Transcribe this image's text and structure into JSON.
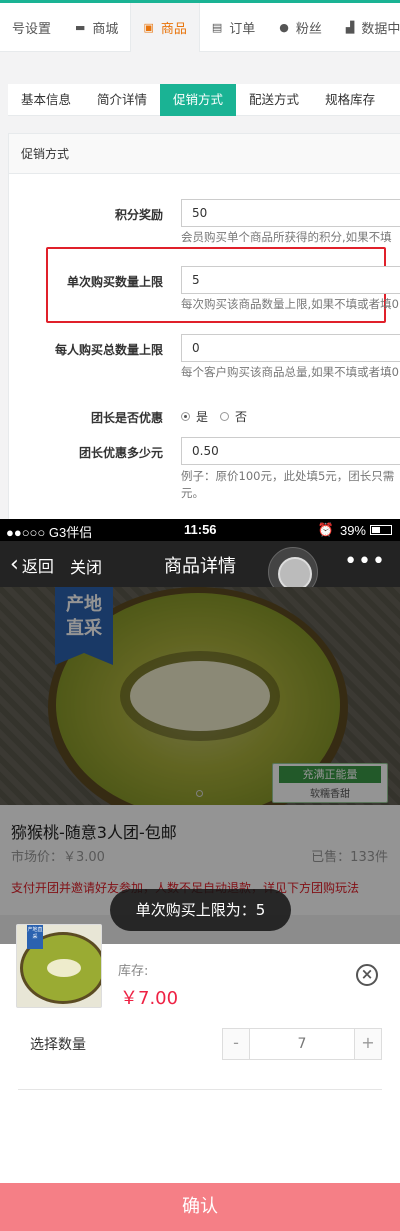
{
  "admin": {
    "topnav": [
      {
        "label": "号设置",
        "icon": "none"
      },
      {
        "label": "商城",
        "icon": "monitor-icon"
      },
      {
        "label": "商品",
        "icon": "gift-icon",
        "active": true
      },
      {
        "label": "订单",
        "icon": "cart-icon"
      },
      {
        "label": "粉丝",
        "icon": "user-icon"
      },
      {
        "label": "数据中心",
        "icon": "chart-icon"
      }
    ],
    "tabs": [
      {
        "label": "基本信息"
      },
      {
        "label": "简介详情"
      },
      {
        "label": "促销方式",
        "active": true
      },
      {
        "label": "配送方式"
      },
      {
        "label": "规格库存"
      }
    ],
    "panel_title": "促销方式",
    "fields": {
      "points": {
        "label": "积分奖励",
        "value": "50",
        "help": "会员购买单个商品所获得的积分,如果不填"
      },
      "max_single": {
        "label": "单次购买数量上限",
        "value": "5",
        "help": "每次购买该商品数量上限,如果不填或者填0"
      },
      "max_total": {
        "label": "每人购买总数量上限",
        "value": "0",
        "help": "每个客户购买该商品总量,如果不填或者填0"
      },
      "leader_discount": {
        "label": "团长是否优惠",
        "yes": "是",
        "no": "否",
        "selected": "是"
      },
      "leader_amount": {
        "label": "团长优惠多少元",
        "value": "0.50",
        "help1": "例子：原价100元，此处填5元，团长只需",
        "help2": "元。"
      }
    },
    "accent_color": "#1ab394",
    "highlight_color": "#e0202a"
  },
  "phone": {
    "status": {
      "carrier": "●●○○○ G3伴侣",
      "time": "11:56",
      "battery": "39%"
    },
    "nav": {
      "back": "返回",
      "close": "关闭",
      "title": "商品详情",
      "more": "•••"
    },
    "badge": {
      "line1": "产地",
      "line2": "直采"
    },
    "sticker": {
      "line1": "充满正能量",
      "line2": "软糯香甜"
    },
    "product": {
      "name": "猕猴桃-随意3人团-包邮",
      "market_price": "市场价：￥3.00",
      "sold": "已售：133件",
      "rule": "支付开团并邀请好友参加，人数不足自动退款，详见下方团购玩法"
    },
    "toast": "单次购买上限为：5",
    "sheet": {
      "thumb_badge": "产地直采",
      "stock_label": "库存:",
      "price": "￥7.00",
      "qty_label": "选择数量",
      "qty_value": "7",
      "minus": "-",
      "plus": "+",
      "confirm": "确认"
    }
  }
}
